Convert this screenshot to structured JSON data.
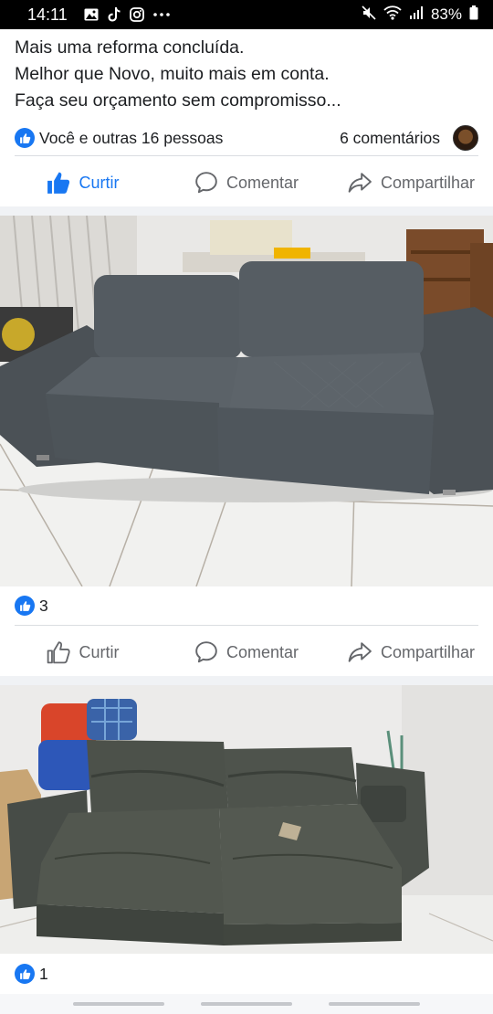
{
  "status_bar": {
    "time": "14:11",
    "battery": "83%",
    "left_icons": [
      "gallery-icon",
      "tiktok-icon",
      "instagram-icon",
      "more-icon"
    ],
    "right_icons": [
      "mute-icon",
      "wifi-icon",
      "signal-icon",
      "battery-icon"
    ]
  },
  "post": {
    "lines": [
      "Mais uma reforma concluída.",
      "Melhor que Novo,  muito mais em conta.",
      "Faça seu orçamento sem compromisso..."
    ],
    "reactions_text": "Você e outras 16 pessoas",
    "comments_text": "6 comentários"
  },
  "actions": {
    "like_label": "Curtir",
    "comment_label": "Comentar",
    "share_label": "Compartilhar"
  },
  "photos": [
    {
      "likes": "3"
    },
    {
      "likes": "1"
    }
  ],
  "colors": {
    "accent": "#1877f2",
    "muted_text": "#65676b",
    "divider": "#dadde1",
    "band": "#f0f2f5"
  }
}
